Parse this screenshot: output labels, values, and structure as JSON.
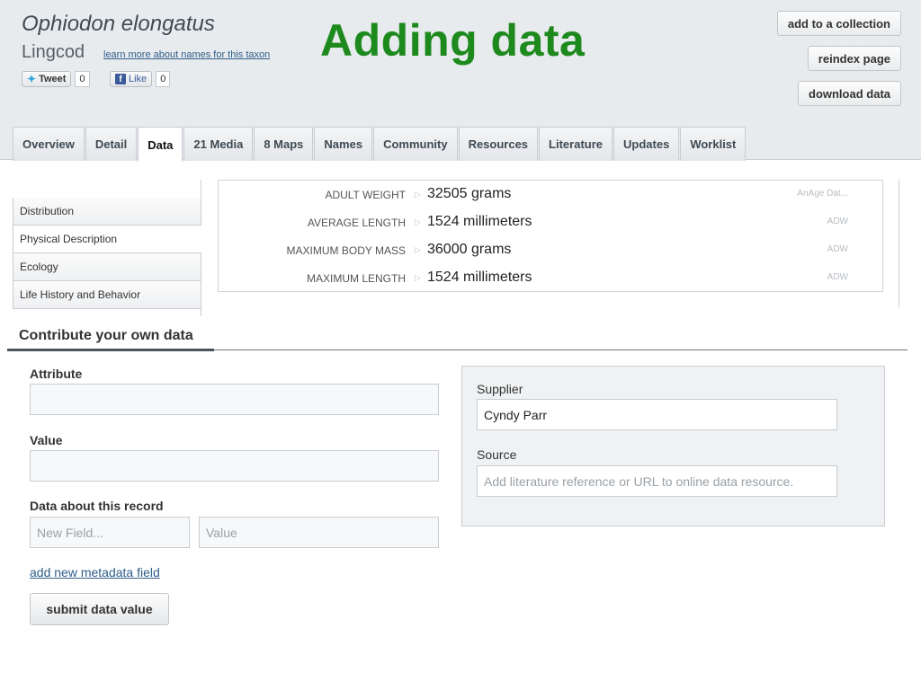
{
  "header": {
    "scientific_name": "Ophiodon elongatus",
    "common_name": "Lingcod",
    "names_link": "learn more about names for this taxon",
    "tweet_label": "Tweet",
    "tweet_count": "0",
    "like_label": "Like",
    "like_count": "0",
    "fb_glyph": "f",
    "overlay_title": "Adding data",
    "overlay_color": "#1e8a1e",
    "buttons": {
      "add_collection": "add to a collection",
      "reindex": "reindex page",
      "download": "download data"
    }
  },
  "tabs": [
    "Overview",
    "Detail",
    "Data",
    "21 Media",
    "8 Maps",
    "Names",
    "Community",
    "Resources",
    "Literature",
    "Updates",
    "Worklist"
  ],
  "active_tab": "Data",
  "sidebar": {
    "items": [
      "Distribution",
      "Physical Description",
      "Ecology",
      "Life History and Behavior"
    ],
    "active": "Physical Description"
  },
  "data_rows": [
    {
      "attribute": "Adult weight",
      "value": "32505 grams",
      "source": "AnAge Dat..."
    },
    {
      "attribute": "Average length",
      "value": "1524 millimeters",
      "source": "ADW"
    },
    {
      "attribute": "Maximum body mass",
      "value": "36000 grams",
      "source": "ADW"
    },
    {
      "attribute": "Maximum length",
      "value": "1524 millimeters",
      "source": "ADW"
    }
  ],
  "contribute": {
    "heading": "Contribute your own data",
    "attribute_label": "Attribute",
    "attribute_value": "",
    "value_label": "Value",
    "value_value": "",
    "metadata_label": "Data about this record",
    "new_field_placeholder": "New Field...",
    "meta_value_placeholder": "Value",
    "add_metadata_link": "add new metadata field",
    "submit_label": "submit data value",
    "supplier_label": "Supplier",
    "supplier_value": "Cyndy Parr",
    "source_label": "Source",
    "source_placeholder": "Add literature reference or URL to online data resource."
  }
}
